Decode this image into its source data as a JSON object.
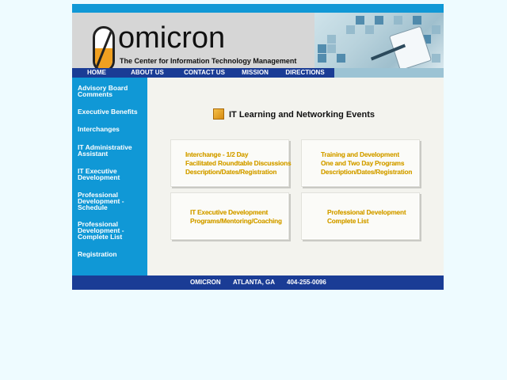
{
  "header": {
    "brand": "omicron",
    "tagline": "The Center for Information Technology Management"
  },
  "nav": {
    "items": [
      "HOME",
      "ABOUT US",
      "CONTACT US",
      "MISSION",
      "DIRECTIONS"
    ]
  },
  "sidebar": {
    "items": [
      {
        "line1": "Advisory Board",
        "line2": "Comments"
      },
      {
        "line1": "Executive Benefits",
        "line2": ""
      },
      {
        "line1": "Interchanges",
        "line2": ""
      },
      {
        "line1": "IT Administrative",
        "line2": "Assistant"
      },
      {
        "line1": "IT Executive",
        "line2": "Development"
      },
      {
        "line1": "Professional",
        "line2": "Development -",
        "line3": "Schedule"
      },
      {
        "line1": "Professional",
        "line2": "Development -",
        "line3": "Complete List"
      },
      {
        "line1": "Registration",
        "line2": ""
      }
    ]
  },
  "main": {
    "title": "IT Learning and Networking Events",
    "cards": [
      {
        "lines": [
          "Interchange - 1/2 Day",
          "Facilitated Roundtable Discussions",
          "Description/Dates/Registration"
        ]
      },
      {
        "lines": [
          "Training and Development",
          "One and Two Day Programs",
          "Description/Dates/Registration"
        ]
      },
      {
        "lines": [
          "IT Executive Development",
          "Programs/Mentoring/Coaching"
        ]
      },
      {
        "lines": [
          "Professional Development",
          "Complete List"
        ]
      }
    ]
  },
  "footer": {
    "name": "OMICRON",
    "city": "ATLANTA, GA",
    "phone": "404-255-0096"
  },
  "colors": {
    "nav_bg": "#1a3c95",
    "sidebar_bg": "#1098d6",
    "card_text": "#d4a000",
    "page_bg": "#eefbff",
    "content_bg": "#f3f3ee",
    "logo_accent": "#f0a020"
  }
}
